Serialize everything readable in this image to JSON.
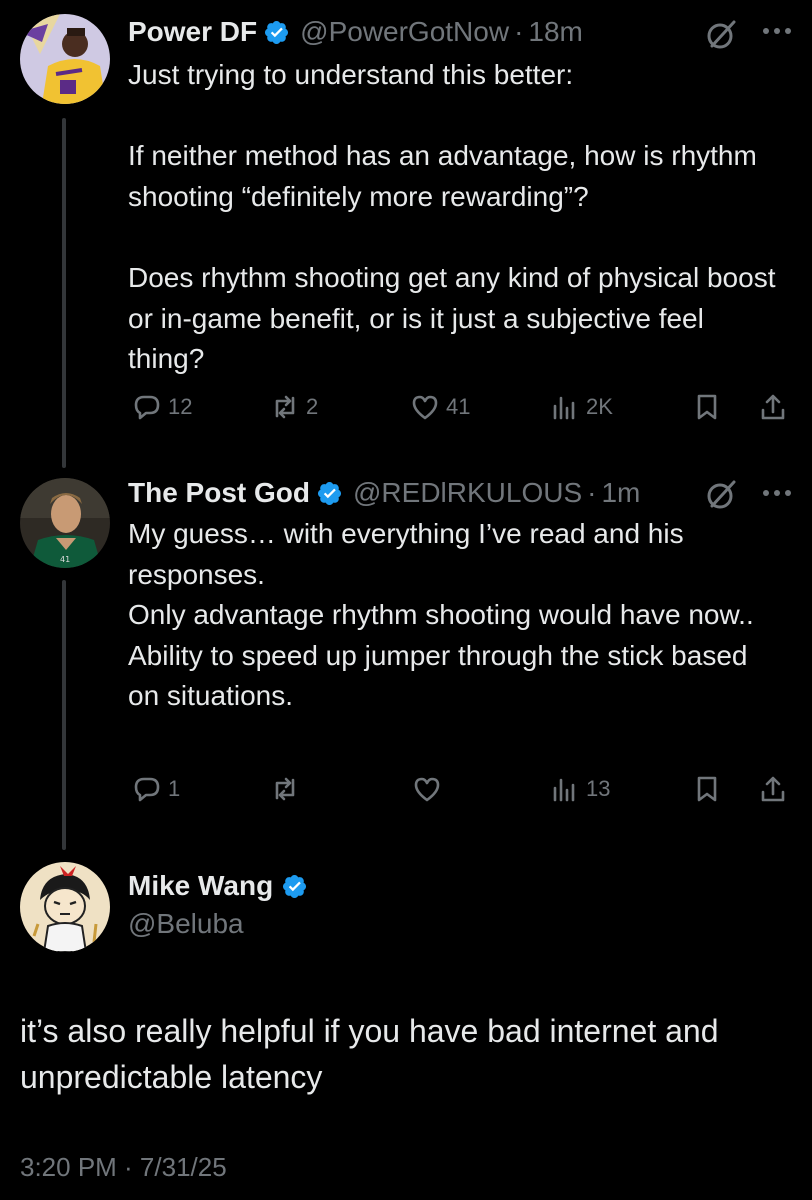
{
  "replies": [
    {
      "name": "Power DF",
      "handle": "@PowerGotNow",
      "separator": "·",
      "time": "18m",
      "text": "Just trying to understand this better:\n\nIf neither method has an advantage, how is rhythm shooting “definitely more rewarding”?\n\nDoes rhythm shooting get any kind of physical boost or in-game benefit, or is it just a subjective feel thing?",
      "replies_count": "12",
      "reposts_count": "2",
      "likes_count": "41",
      "views_count": "2K"
    },
    {
      "name": "The Post God",
      "handle": "@REDlRKULOUS",
      "separator": "·",
      "time": "1m",
      "text": "My guess… with everything I’ve read and his responses.\nOnly advantage rhythm shooting would have now..\nAbility to speed up jumper through the stick based on situations.",
      "replies_count": "1",
      "reposts_count": "",
      "likes_count": "",
      "views_count": "13"
    }
  ],
  "main_tweet": {
    "name": "Mike Wang",
    "handle": "@Beluba",
    "text": "it’s also really helpful if you have bad internet and unpredictable latency",
    "timestamp": "3:20 PM · 7/31/25"
  },
  "colors": {
    "background": "#000000",
    "text": "#e7e9ea",
    "secondary": "#71767b",
    "verified": "#1d9bf0",
    "thread_line": "#333639"
  }
}
